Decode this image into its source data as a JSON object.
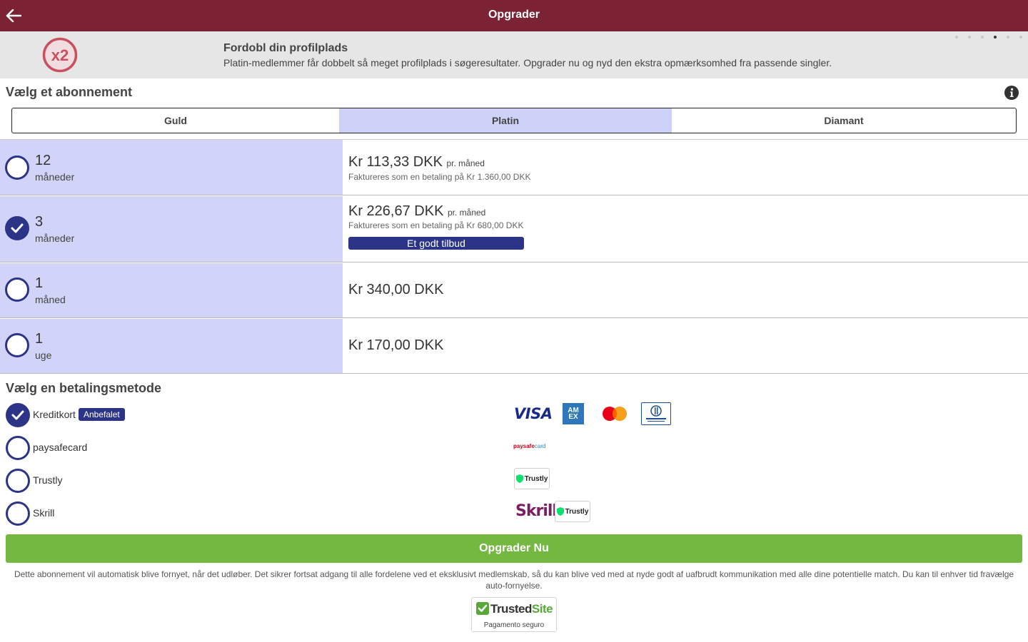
{
  "header": {
    "title": "Opgrader"
  },
  "promo": {
    "badge_text": "x2",
    "headline": "Fordobl din profilplads",
    "description": "Platin-medlemmer får dobbelt så meget profilplads i søgeresultater. Opgrader nu og nyd den ekstra opmærksomhed fra passende singler.",
    "carousel_active_index": 3
  },
  "subscription": {
    "title": "Vælg et abonnement",
    "tabs": [
      {
        "label": "Guld"
      },
      {
        "label": "Platin"
      },
      {
        "label": "Diamant"
      }
    ],
    "selected_tab": "Platin",
    "plans": [
      {
        "num": "12",
        "unit": "måneder",
        "price": "Kr 113,33 DKK",
        "per": "pr. måned",
        "billed": "Faktureres som en betaling på Kr 1.360,00 DKK",
        "selected": false
      },
      {
        "num": "3",
        "unit": "måneder",
        "price": "Kr 226,67 DKK",
        "per": "pr. måned",
        "billed": "Faktureres som en betaling på Kr 680,00 DKK",
        "deal": "Et godt tilbud",
        "selected": true
      },
      {
        "num": "1",
        "unit": "måned",
        "price": "Kr 340,00 DKK",
        "selected": false
      },
      {
        "num": "1",
        "unit": "uge",
        "price": "Kr 170,00 DKK",
        "selected": false
      }
    ]
  },
  "payment": {
    "title": "Vælg en betalingsmetode",
    "methods": [
      {
        "label": "Kreditkort",
        "badge": "Anbefalet",
        "selected": true
      },
      {
        "label": "paysafecard",
        "selected": false
      },
      {
        "label": "Trustly",
        "selected": false
      },
      {
        "label": "Skrill",
        "selected": false
      }
    ],
    "logos": {
      "visa": "VISA",
      "amex": "AM EX",
      "paysafe_a": "paysafe",
      "paysafe_b": "card",
      "trustly": "Trustly",
      "skrill": "Skrill"
    }
  },
  "cta": {
    "label": "Opgrader Nu"
  },
  "disclaimer": "Dette abonnement vil automatisk blive fornyet, når det udløber. Det sikrer fortsat adgang til alle fordelene ved et eksklusivt medlemskab, så du kan blive ved med at nyde godt af uafbrudt kommunikation med alle dine potentielle match. Du kan til enhver tid fravælge auto-fornyelse.",
  "trusted_site": {
    "name_a": "Trusted",
    "name_b": "Site",
    "sub": "Pagamento seguro"
  },
  "colors": {
    "header_bg": "#7b2334",
    "accent": "#2b3487",
    "selected_tab_bg": "#cfd2f8",
    "cta_bg": "#74b842"
  }
}
